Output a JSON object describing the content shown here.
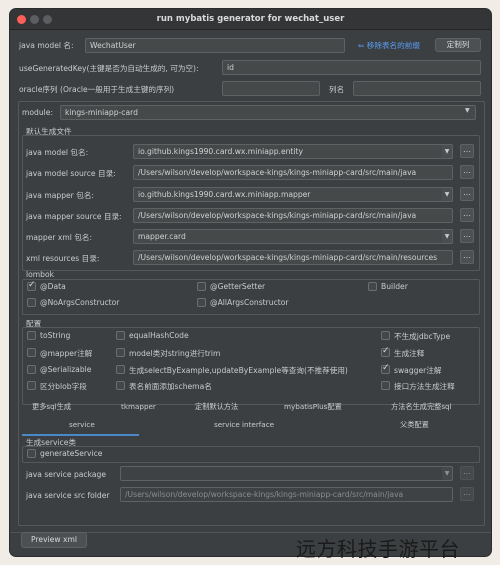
{
  "window": {
    "title": "run mybatis generator for wechat_user"
  },
  "top": {
    "model_name_label": "java model 名:",
    "model_name_value": "WechatUser",
    "remove_prefix_link": "⇐ 移除表名的前缀",
    "custom_column_button": "定制列",
    "use_generated_key_label": "useGeneratedKey(主键是否为自动生成的, 可为空):",
    "use_generated_key_value": "id",
    "oracle_seq_label": "oracle序列 (Oracle一般用于生成主键的序列)",
    "oracle_seq_value": "",
    "column_name_label": "列名",
    "column_name_value": ""
  },
  "module": {
    "label": "module:",
    "value": "kings-miniapp-card"
  },
  "default_files": {
    "section_title": "默认生成文件",
    "rows": [
      {
        "label": "java model 包名:",
        "value": "io.github.kings1990.card.wx.miniapp.entity",
        "has_dropdown": true
      },
      {
        "label": "java model source 目录:",
        "value": "/Users/wilson/develop/workspace-kings/kings-miniapp-card/src/main/java",
        "has_dropdown": false
      },
      {
        "label": "java mapper 包名:",
        "value": "io.github.kings1990.card.wx.miniapp.mapper",
        "has_dropdown": true
      },
      {
        "label": "java mapper source 目录:",
        "value": "/Users/wilson/develop/workspace-kings/kings-miniapp-card/src/main/java",
        "has_dropdown": false
      },
      {
        "label": "mapper xml 包名:",
        "value": "mapper.card",
        "has_dropdown": true
      },
      {
        "label": "xml resources 目录:",
        "value": "/Users/wilson/develop/workspace-kings/kings-miniapp-card/src/main/resources",
        "has_dropdown": false
      }
    ]
  },
  "lombok": {
    "section_title": "lombok",
    "options": [
      {
        "label": "@Data",
        "checked": true
      },
      {
        "label": "@GetterSetter",
        "checked": false
      },
      {
        "label": "Builder",
        "checked": false
      },
      {
        "label": "@NoArgsConstructor",
        "checked": false
      },
      {
        "label": "@AllArgsConstructor",
        "checked": false
      }
    ]
  },
  "config": {
    "section_title": "配置",
    "options": [
      {
        "label": "toString",
        "checked": false
      },
      {
        "label": "equalHashCode",
        "checked": false
      },
      {
        "label": "不生成jdbcType",
        "checked": false
      },
      {
        "label": "@mapper注解",
        "checked": false
      },
      {
        "label": "model类对string进行trim",
        "checked": false
      },
      {
        "label": "生成注释",
        "checked": true
      },
      {
        "label": "@Serializable",
        "checked": false
      },
      {
        "label": "生成selectByExample,updateByExample等查询(不推荐使用)",
        "checked": false
      },
      {
        "label": "swagger注解",
        "checked": true
      },
      {
        "label": "区分blob字段",
        "checked": false
      },
      {
        "label": "表名前面添加schema名",
        "checked": false
      },
      {
        "label": "接口方法生成注释",
        "checked": false
      }
    ]
  },
  "tabs_row1": [
    "更多sql生成",
    "tkmapper",
    "定制默认方法",
    "mybatisPlus配置",
    "方法名生成完整sql"
  ],
  "tabs_row2": [
    "service",
    "service interface",
    "父类配置"
  ],
  "active_tab": "service",
  "service": {
    "section_title": "生成service类",
    "generate_label": "generateService",
    "generate_checked": false,
    "package_label": "java service package",
    "package_value": "",
    "src_label": "java service src folder",
    "src_value": "/Users/wilson/develop/workspace-kings/kings-miniapp-card/src/main/java"
  },
  "footer": {
    "preview_button": "Preview xml"
  },
  "watermark": "远方科技手游平台",
  "colors": {
    "accent": "#4a88c7",
    "link": "#589df6",
    "window_bg": "#3c3f41",
    "page_bg": "#f1ede6"
  }
}
